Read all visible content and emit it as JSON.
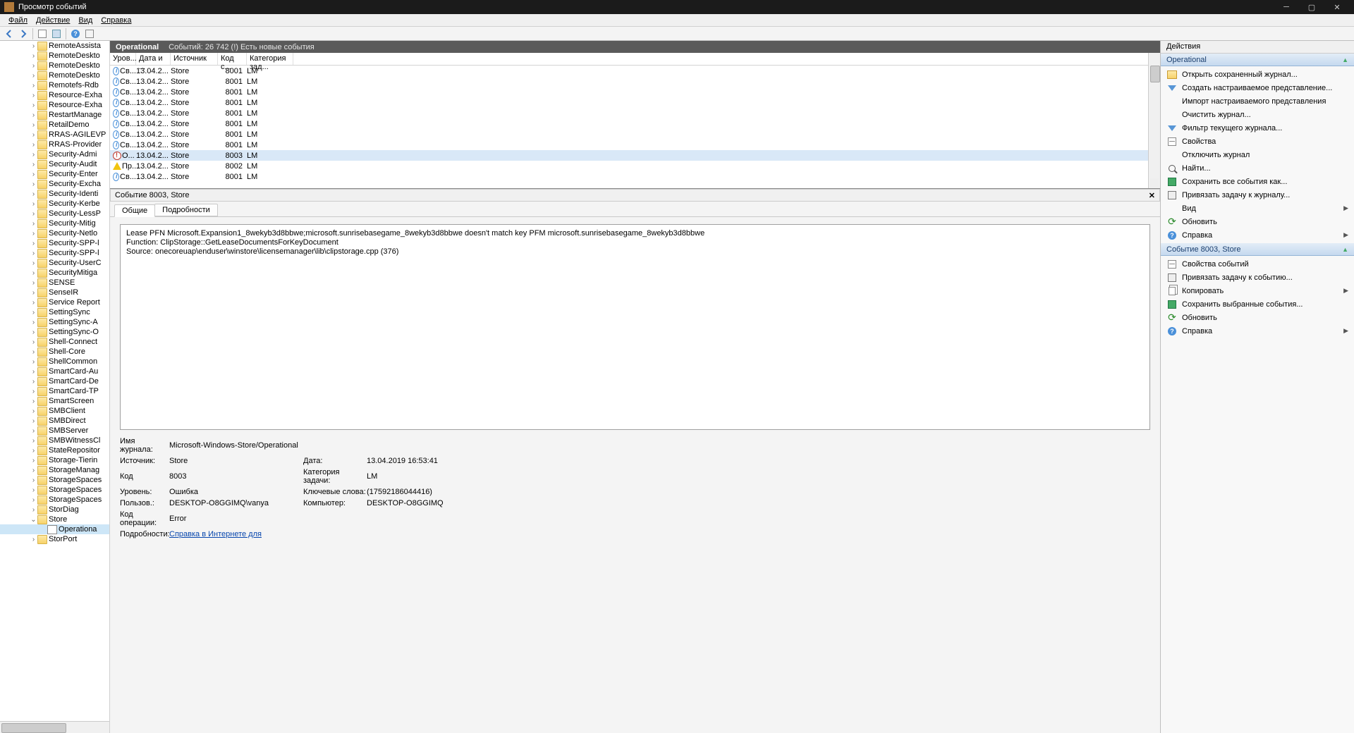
{
  "window": {
    "title": "Просмотр событий"
  },
  "menu": {
    "file": "Файл",
    "action": "Действие",
    "view": "Вид",
    "help": "Справка"
  },
  "tree": [
    {
      "l": "RemoteAssista",
      "d": 3,
      "tw": ">",
      "scroll": true
    },
    {
      "l": "RemoteDeskto",
      "d": 3,
      "tw": ">"
    },
    {
      "l": "RemoteDeskto",
      "d": 3,
      "tw": ">"
    },
    {
      "l": "RemoteDeskto",
      "d": 3,
      "tw": ">"
    },
    {
      "l": "Remotefs-Rdb",
      "d": 3,
      "tw": ">"
    },
    {
      "l": "Resource-Exha",
      "d": 3,
      "tw": ">"
    },
    {
      "l": "Resource-Exha",
      "d": 3,
      "tw": ">"
    },
    {
      "l": "RestartManage",
      "d": 3,
      "tw": ">"
    },
    {
      "l": "RetailDemo",
      "d": 3,
      "tw": ">"
    },
    {
      "l": "RRAS-AGILEVP",
      "d": 3,
      "tw": ">"
    },
    {
      "l": "RRAS-Provider",
      "d": 3,
      "tw": ">"
    },
    {
      "l": "Security-Admi",
      "d": 3,
      "tw": ">"
    },
    {
      "l": "Security-Audit",
      "d": 3,
      "tw": ">"
    },
    {
      "l": "Security-Enter",
      "d": 3,
      "tw": ">"
    },
    {
      "l": "Security-Excha",
      "d": 3,
      "tw": ">"
    },
    {
      "l": "Security-Identi",
      "d": 3,
      "tw": ">"
    },
    {
      "l": "Security-Kerbe",
      "d": 3,
      "tw": ">"
    },
    {
      "l": "Security-LessP",
      "d": 3,
      "tw": ">"
    },
    {
      "l": "Security-Mitig",
      "d": 3,
      "tw": ">"
    },
    {
      "l": "Security-Netlo",
      "d": 3,
      "tw": ">"
    },
    {
      "l": "Security-SPP-l",
      "d": 3,
      "tw": ">"
    },
    {
      "l": "Security-SPP-l",
      "d": 3,
      "tw": ">"
    },
    {
      "l": "Security-UserC",
      "d": 3,
      "tw": ">"
    },
    {
      "l": "SecurityMitiga",
      "d": 3,
      "tw": ">"
    },
    {
      "l": "SENSE",
      "d": 3,
      "tw": ">"
    },
    {
      "l": "SenseIR",
      "d": 3,
      "tw": ">"
    },
    {
      "l": "Service Report",
      "d": 3,
      "tw": ">"
    },
    {
      "l": "SettingSync",
      "d": 3,
      "tw": ">"
    },
    {
      "l": "SettingSync-A",
      "d": 3,
      "tw": ">"
    },
    {
      "l": "SettingSync-O",
      "d": 3,
      "tw": ">"
    },
    {
      "l": "Shell-Connect",
      "d": 3,
      "tw": ">"
    },
    {
      "l": "Shell-Core",
      "d": 3,
      "tw": ">"
    },
    {
      "l": "ShellCommon",
      "d": 3,
      "tw": ">"
    },
    {
      "l": "SmartCard-Au",
      "d": 3,
      "tw": ">"
    },
    {
      "l": "SmartCard-De",
      "d": 3,
      "tw": ">"
    },
    {
      "l": "SmartCard-TP",
      "d": 3,
      "tw": ">"
    },
    {
      "l": "SmartScreen",
      "d": 3,
      "tw": ">"
    },
    {
      "l": "SMBClient",
      "d": 3,
      "tw": ">"
    },
    {
      "l": "SMBDirect",
      "d": 3,
      "tw": ">"
    },
    {
      "l": "SMBServer",
      "d": 3,
      "tw": ">"
    },
    {
      "l": "SMBWitnessCl",
      "d": 3,
      "tw": ">"
    },
    {
      "l": "StateRepositor",
      "d": 3,
      "tw": ">"
    },
    {
      "l": "Storage-Tierin",
      "d": 3,
      "tw": ">"
    },
    {
      "l": "StorageManag",
      "d": 3,
      "tw": ">"
    },
    {
      "l": "StorageSpaces",
      "d": 3,
      "tw": ">"
    },
    {
      "l": "StorageSpaces",
      "d": 3,
      "tw": ">"
    },
    {
      "l": "StorageSpaces",
      "d": 3,
      "tw": ">"
    },
    {
      "l": "StorDiag",
      "d": 3,
      "tw": ">"
    },
    {
      "l": "Store",
      "d": 3,
      "tw": "v"
    },
    {
      "l": "Operationa",
      "d": 4,
      "tw": "",
      "leaf": true,
      "sel": true
    },
    {
      "l": "StorPort",
      "d": 3,
      "tw": ">"
    }
  ],
  "center": {
    "hdr_title": "Operational",
    "hdr_sub": "Событий: 26 742 (!) Есть новые события",
    "cols": [
      "Уров...",
      "Дата и ...",
      "Источник",
      "Код с...",
      "Категория зад..."
    ],
    "rows": [
      {
        "icon": "info",
        "lv": "Св...",
        "dt": "13.04.2...",
        "src": "Store",
        "code": "8001",
        "cat": "LM"
      },
      {
        "icon": "info",
        "lv": "Св...",
        "dt": "13.04.2...",
        "src": "Store",
        "code": "8001",
        "cat": "LM"
      },
      {
        "icon": "info",
        "lv": "Св...",
        "dt": "13.04.2...",
        "src": "Store",
        "code": "8001",
        "cat": "LM"
      },
      {
        "icon": "info",
        "lv": "Св...",
        "dt": "13.04.2...",
        "src": "Store",
        "code": "8001",
        "cat": "LM"
      },
      {
        "icon": "info",
        "lv": "Св...",
        "dt": "13.04.2...",
        "src": "Store",
        "code": "8001",
        "cat": "LM"
      },
      {
        "icon": "info",
        "lv": "Св...",
        "dt": "13.04.2...",
        "src": "Store",
        "code": "8001",
        "cat": "LM"
      },
      {
        "icon": "info",
        "lv": "Св...",
        "dt": "13.04.2...",
        "src": "Store",
        "code": "8001",
        "cat": "LM"
      },
      {
        "icon": "info",
        "lv": "Св...",
        "dt": "13.04.2...",
        "src": "Store",
        "code": "8001",
        "cat": "LM"
      },
      {
        "icon": "err",
        "lv": "О...",
        "dt": "13.04.2...",
        "src": "Store",
        "code": "8003",
        "cat": "LM",
        "sel": true
      },
      {
        "icon": "warn",
        "lv": "Пр...",
        "dt": "13.04.2...",
        "src": "Store",
        "code": "8002",
        "cat": "LM"
      },
      {
        "icon": "info",
        "lv": "Св...",
        "dt": "13.04.2...",
        "src": "Store",
        "code": "8001",
        "cat": "LM"
      }
    ]
  },
  "detail": {
    "title": "Событие 8003, Store",
    "tab_general": "Общие",
    "tab_details": "Подробности",
    "msg_l1": "Lease PFN Microsoft.Expansion1_8wekyb3d8bbwe;microsoft.sunrisebasegame_8wekyb3d8bbwe doesn't match key PFM microsoft.sunrisebasegame_8wekyb3d8bbwe",
    "msg_l2": "Function: ClipStorage::GetLeaseDocumentsForKeyDocument",
    "msg_l3": "Source: onecoreuap\\enduser\\winstore\\licensemanager\\lib\\clipstorage.cpp (376)",
    "props": {
      "log_lbl": "Имя журнала:",
      "log_val": "Microsoft-Windows-Store/Operational",
      "src_lbl": "Источник:",
      "src_val": "Store",
      "date_lbl": "Дата:",
      "date_val": "13.04.2019 16:53:41",
      "code_lbl": "Код",
      "code_val": "8003",
      "cat_lbl": "Категория задачи:",
      "cat_val": "LM",
      "lvl_lbl": "Уровень:",
      "lvl_val": "Ошибка",
      "kw_lbl": "Ключевые слова:",
      "kw_val": "(17592186044416)",
      "usr_lbl": "Пользов.:",
      "usr_val": "DESKTOP-O8GGIMQ\\vanya",
      "comp_lbl": "Компьютер:",
      "comp_val": "DESKTOP-O8GGIMQ",
      "op_lbl": "Код операции:",
      "op_val": "Error",
      "det_lbl": "Подробности:",
      "det_link": "Справка в Интернете для "
    }
  },
  "actions": {
    "title": "Действия",
    "sec1": "Operational",
    "items1": [
      {
        "ic": "open",
        "t": "Открыть сохраненный журнал..."
      },
      {
        "ic": "filter",
        "t": "Создать настраиваемое представление..."
      },
      {
        "ic": "",
        "t": "Импорт настраиваемого представления"
      },
      {
        "ic": "",
        "t": "Очистить журнал..."
      },
      {
        "ic": "filter",
        "t": "Фильтр текущего журнала..."
      },
      {
        "ic": "prop",
        "t": "Свойства"
      },
      {
        "ic": "",
        "t": "Отключить журнал"
      },
      {
        "ic": "find",
        "t": "Найти..."
      },
      {
        "ic": "save",
        "t": "Сохранить все события как..."
      },
      {
        "ic": "task",
        "t": "Привязать задачу к журналу..."
      },
      {
        "ic": "",
        "t": "Вид",
        "sub": "▶"
      },
      {
        "ic": "refresh",
        "t": "Обновить"
      },
      {
        "ic": "help",
        "t": "Справка",
        "sub": "▶"
      }
    ],
    "sec2": "Событие 8003, Store",
    "items2": [
      {
        "ic": "prop",
        "t": "Свойства событий"
      },
      {
        "ic": "task",
        "t": "Привязать задачу к событию..."
      },
      {
        "ic": "copy",
        "t": "Копировать",
        "sub": "▶"
      },
      {
        "ic": "save",
        "t": "Сохранить выбранные события..."
      },
      {
        "ic": "refresh",
        "t": "Обновить"
      },
      {
        "ic": "help",
        "t": "Справка",
        "sub": "▶"
      }
    ]
  }
}
